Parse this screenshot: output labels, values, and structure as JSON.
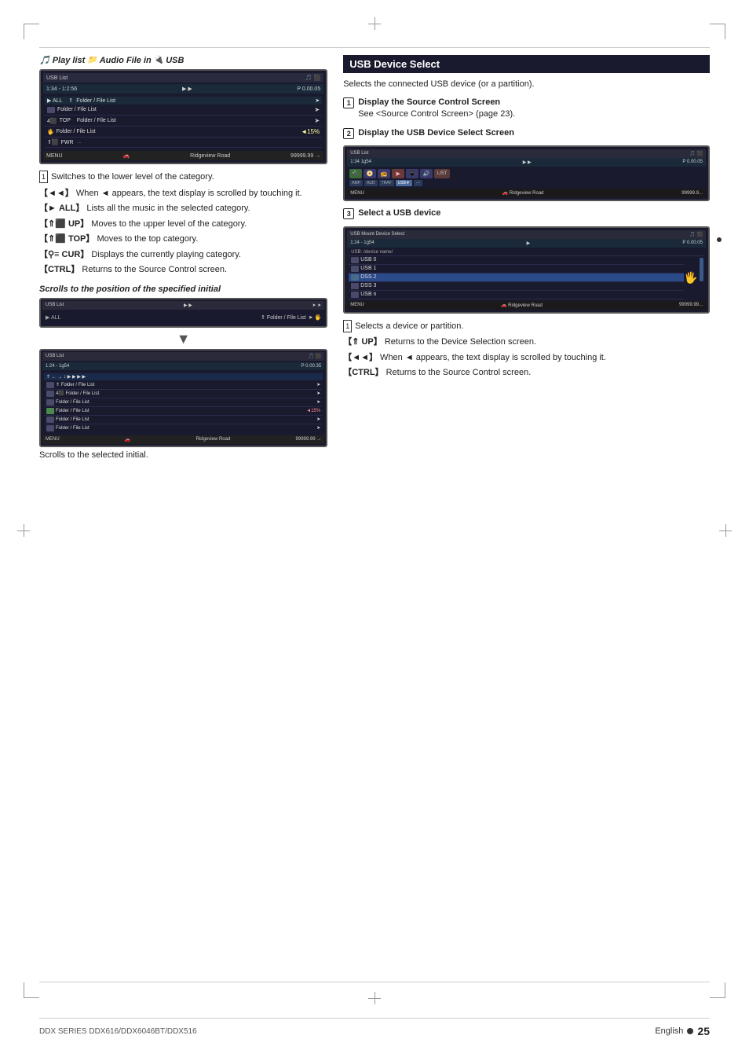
{
  "page": {
    "footer_model": "DDX SERIES  DDX616/DDX6046BT/DDX516",
    "footer_lang": "English",
    "footer_page": "25"
  },
  "left_col": {
    "playlist_header": "Play list",
    "playlist_subheader": "Audio File  in",
    "playlist_source": "USB",
    "screen1": {
      "top_label": "USB List",
      "time": "1:34 - 1:2:56",
      "position": "P 0.00.05",
      "bottom_label": "NENU",
      "bottom_right": "Ridgeview Road",
      "score": "99999.99"
    },
    "desc_items": [
      {
        "num": "1",
        "text": "Switches to the lower level of the category."
      },
      {
        "bracket": "[ ◄◄ ]",
        "text": "When ◄ appears, the text display is scrolled by touching it."
      },
      {
        "bracket": "[ ► ALL]",
        "text": "Lists all the music in the selected category."
      },
      {
        "bracket": "[ ⇑⬛ UP]",
        "text": "Moves to the upper level of the category."
      },
      {
        "bracket": "[ ⇑⬛ TOP]",
        "text": "Moves to the top category."
      },
      {
        "bracket": "[⚲≡ CUR]",
        "text": "Displays the currently playing category."
      },
      {
        "bracket": "[CTRL]",
        "text": "Returns to the Source Control screen."
      }
    ],
    "scrolls_section": {
      "title": "Scrolls to the position of the specified initial",
      "bottom_text": "Scrolls to the selected initial."
    }
  },
  "right_col": {
    "section_title": "USB Device Select",
    "section_subtitle": "Selects the connected USB device (or a partition).",
    "steps": [
      {
        "num": "1",
        "bold": "Display the Source Control Screen",
        "text": "See <Source Control Screen> (page 23)."
      },
      {
        "num": "2",
        "bold": "Display the USB Device Select Screen"
      },
      {
        "num": "3",
        "bold": "Select a USB device"
      }
    ],
    "step3_desc": [
      {
        "num": "1",
        "text": "Selects a device or partition."
      },
      {
        "bracket": "[⇑ UP]",
        "text": "Returns to the Device Selection screen."
      },
      {
        "bracket": "[ ◄◄ ]",
        "text": "When ◄ appears, the text display is scrolled by touching it."
      },
      {
        "bracket": "[CTRL]",
        "text": "Returns to the Source Control screen."
      }
    ],
    "usb_select_screen": {
      "top": "USB List",
      "bottom_label": "NENU",
      "bottom_song": "Ridgeview Road",
      "bottom_score": "99999.9..."
    },
    "usb_mount_screen": {
      "top": "USB Mount Device Select",
      "time_label": "1:24 - 1g54",
      "position": "P 0.00.05",
      "device_label": "USB: /device name/",
      "items": [
        "USB 0",
        "USB 1",
        "DSS 2",
        "DSS 3",
        "USB n"
      ],
      "bottom_label": "NENU",
      "bottom_song": "Ridgeview Road",
      "bottom_score": "99999.99..."
    }
  }
}
